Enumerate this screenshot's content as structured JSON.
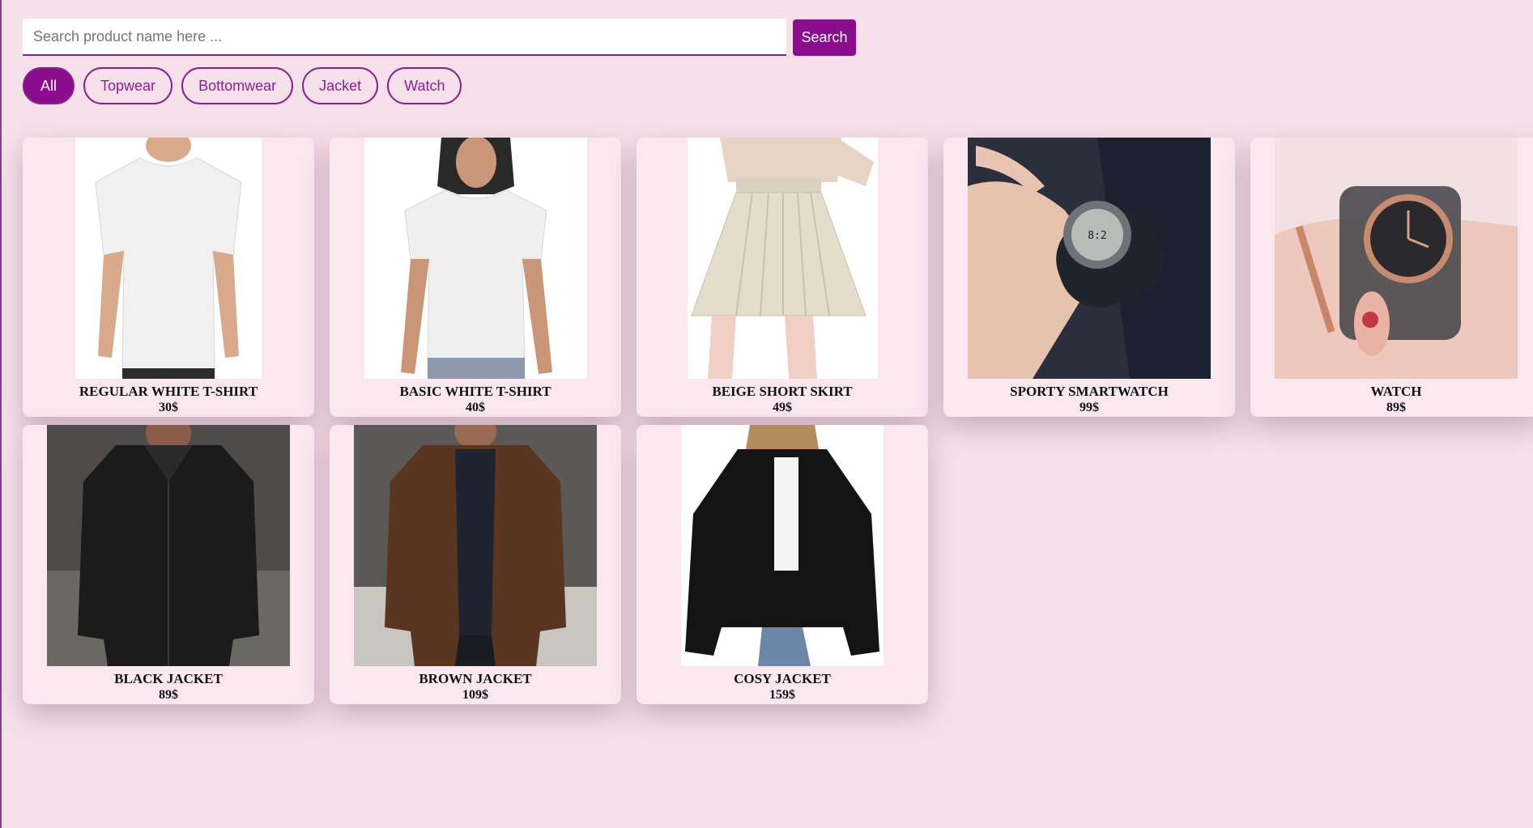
{
  "search": {
    "placeholder": "Search product name here ...",
    "button_label": "Search"
  },
  "filters": [
    {
      "label": "All",
      "active": true
    },
    {
      "label": "Topwear",
      "active": false
    },
    {
      "label": "Bottomwear",
      "active": false
    },
    {
      "label": "Jacket",
      "active": false
    },
    {
      "label": "Watch",
      "active": false
    }
  ],
  "products": [
    {
      "name": "REGULAR WHITE T-SHIRT",
      "price": "30$",
      "image": "white-tshirt-man-image"
    },
    {
      "name": "BASIC WHITE T-SHIRT",
      "price": "40$",
      "image": "white-tshirt-woman-image"
    },
    {
      "name": "BEIGE SHORT SKIRT",
      "price": "49$",
      "image": "beige-skirt-image"
    },
    {
      "name": "SPORTY SMARTWATCH",
      "price": "99$",
      "image": "smartwatch-image"
    },
    {
      "name": "WATCH",
      "price": "89$",
      "image": "watch-image"
    },
    {
      "name": "BLACK JACKET",
      "price": "89$",
      "image": "black-jacket-image"
    },
    {
      "name": "BROWN JACKET",
      "price": "109$",
      "image": "brown-jacket-image"
    },
    {
      "name": "COSY JACKET",
      "price": "159$",
      "image": "cosy-jacket-image"
    }
  ],
  "colors": {
    "background": "#f6e1ea",
    "accent": "#8a0d8d",
    "card": "#fbe8ef"
  }
}
